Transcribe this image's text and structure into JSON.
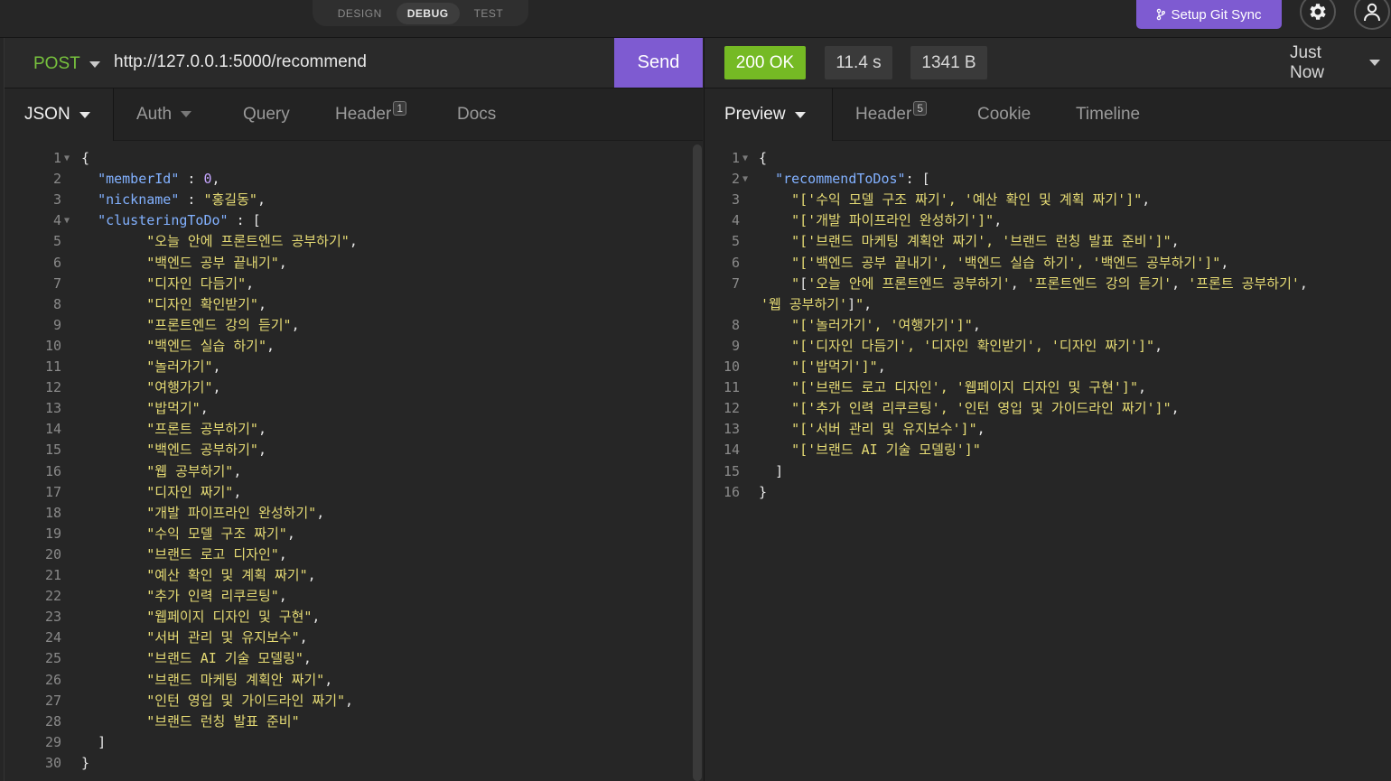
{
  "modes": [
    "DESIGN",
    "DEBUG",
    "TEST"
  ],
  "active_mode": "DEBUG",
  "git_sync": {
    "icon": "git-branch-icon",
    "label": "Setup Git Sync"
  },
  "request": {
    "method": "POST",
    "url": "http://127.0.0.1:5000/recommend",
    "send_label": "Send",
    "tabs": [
      {
        "label": "JSON",
        "active": true
      },
      {
        "label": "Auth"
      },
      {
        "label": "Query"
      },
      {
        "label": "Header",
        "badge": "1"
      },
      {
        "label": "Docs"
      }
    ],
    "body_lines": [
      "{",
      "  \"memberId\" : 0,",
      "  \"nickname\" : \"홍길동\",",
      "  \"clusteringToDo\" : [",
      "        \"오늘 안에 프론트엔드 공부하기\",",
      "        \"백엔드 공부 끝내기\",",
      "        \"디자인 다듬기\",",
      "        \"디자인 확인받기\",",
      "        \"프론트엔드 강의 듣기\",",
      "        \"백엔드 실습 하기\",",
      "        \"놀러가기\",",
      "        \"여행가기\",",
      "        \"밥먹기\",",
      "        \"프론트 공부하기\",",
      "        \"백엔드 공부하기\",",
      "        \"웹 공부하기\",",
      "        \"디자인 짜기\",",
      "        \"개발 파이프라인 완성하기\",",
      "        \"수익 모델 구조 짜기\",",
      "        \"브랜드 로고 디자인\",",
      "        \"예산 확인 및 계획 짜기\",",
      "        \"추가 인력 리쿠르팅\",",
      "        \"웹페이지 디자인 및 구현\",",
      "        \"서버 관리 및 유지보수\",",
      "        \"브랜드 AI 기술 모델링\",",
      "        \"브랜드 마케팅 계획안 짜기\",",
      "        \"인턴 영입 및 가이드라인 짜기\",",
      "        \"브랜드 런칭 발표 준비\"",
      "  ]",
      "}"
    ]
  },
  "response": {
    "status": "200 OK",
    "time": "11.4 s",
    "size": "1341 B",
    "when": "Just Now",
    "tabs": [
      {
        "label": "Preview",
        "active": true
      },
      {
        "label": "Header",
        "badge": "5"
      },
      {
        "label": "Cookie"
      },
      {
        "label": "Timeline"
      }
    ],
    "body_lines": [
      {
        "n": "1",
        "t": "{"
      },
      {
        "n": "2",
        "t": "  \"recommendToDos\": ["
      },
      {
        "n": "3",
        "t": "    \"['수익 모델 구조 짜기', '예산 확인 및 계획 짜기']\","
      },
      {
        "n": "4",
        "t": "    \"['개발 파이프라인 완성하기']\","
      },
      {
        "n": "5",
        "t": "    \"['브랜드 마케팅 계획안 짜기', '브랜드 런칭 발표 준비']\","
      },
      {
        "n": "6",
        "t": "    \"['백엔드 공부 끝내기', '백엔드 실습 하기', '백엔드 공부하기']\","
      },
      {
        "n": "7",
        "t": "    \"['오늘 안에 프론트엔드 공부하기', '프론트엔드 강의 듣기', '프론트 공부하기',"
      },
      {
        "n": "",
        "t": "'웹 공부하기']\","
      },
      {
        "n": "8",
        "t": "    \"['놀러가기', '여행가기']\","
      },
      {
        "n": "9",
        "t": "    \"['디자인 다듬기', '디자인 확인받기', '디자인 짜기']\","
      },
      {
        "n": "10",
        "t": "    \"['밥먹기']\","
      },
      {
        "n": "11",
        "t": "    \"['브랜드 로고 디자인', '웹페이지 디자인 및 구현']\","
      },
      {
        "n": "12",
        "t": "    \"['추가 인력 리쿠르팅', '인턴 영입 및 가이드라인 짜기']\","
      },
      {
        "n": "13",
        "t": "    \"['서버 관리 및 유지보수']\","
      },
      {
        "n": "14",
        "t": "    \"['브랜드 AI 기술 모델링']\""
      },
      {
        "n": "15",
        "t": "  ]"
      },
      {
        "n": "16",
        "t": "}"
      }
    ]
  }
}
